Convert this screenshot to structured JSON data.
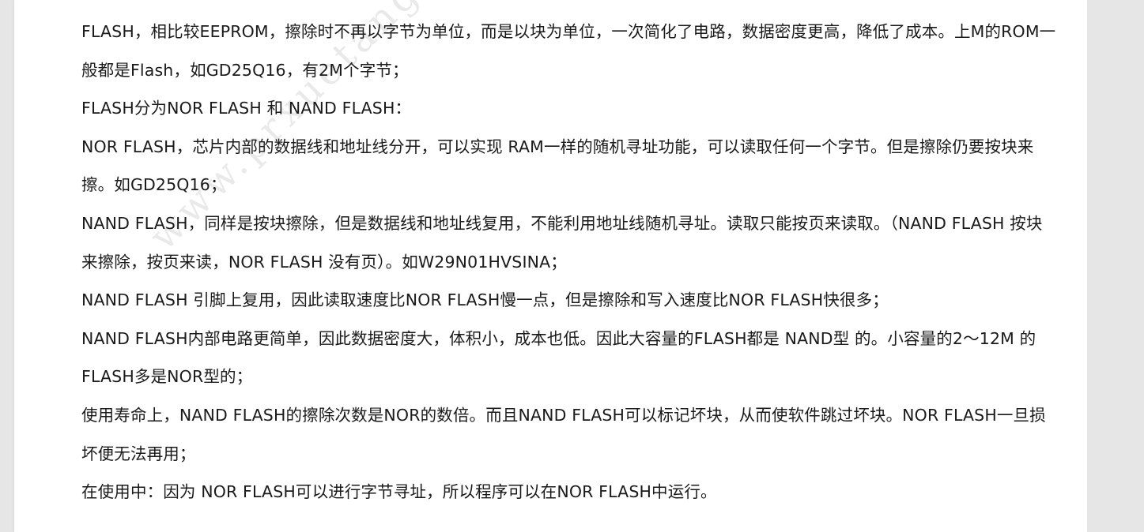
{
  "watermark": "www.prxuetang.com",
  "items": [
    {
      "bullet": "round",
      "text": "FLASH，相比较EEPROM，擦除时不再以字节为单位，而是以块为单位，一次简化了电路，数据密度更高，降低了成本。上M的ROM一般都是Flash，如GD25Q16，有2M个字节；"
    },
    {
      "bullet": "round",
      "text": "FLASH分为NOR FLASH 和 NAND FLASH："
    },
    {
      "bullet": "dot",
      "text": "NOR FLASH，芯片内部的数据线和地址线分开，可以实现 RAM一样的随机寻址功能，可以读取任何一个字节。但是擦除仍要按块来擦。如GD25Q16；"
    },
    {
      "bullet": "dot",
      "text": "NAND FLASH，同样是按块擦除，但是数据线和地址线复用，不能利用地址线随机寻址。读取只能按页来读取。（NAND FLASH 按块来擦除，按页来读，NOR FLASH 没有页）。如W29N01HVSINA；"
    },
    {
      "bullet": "dot",
      "text": "NAND FLASH 引脚上复用，因此读取速度比NOR FLASH慢一点，但是擦除和写入速度比NOR FLASH快很多；"
    },
    {
      "bullet": "dot",
      "text": "NAND FLASH内部电路更简单，因此数据密度大，体积小，成本也低。因此大容量的FLASH都是 NAND型 的。小容量的2～12M 的 FLASH多是NOR型的；"
    },
    {
      "bullet": "dot",
      "text": "使用寿命上，NAND FLASH的擦除次数是NOR的数倍。而且NAND FLASH可以标记坏块，从而使软件跳过坏块。NOR FLASH一旦损坏便无法再用；"
    },
    {
      "bullet": "dot",
      "text": "在使用中：因为 NOR FLASH可以进行字节寻址，所以程序可以在NOR FLASH中运行。"
    }
  ]
}
